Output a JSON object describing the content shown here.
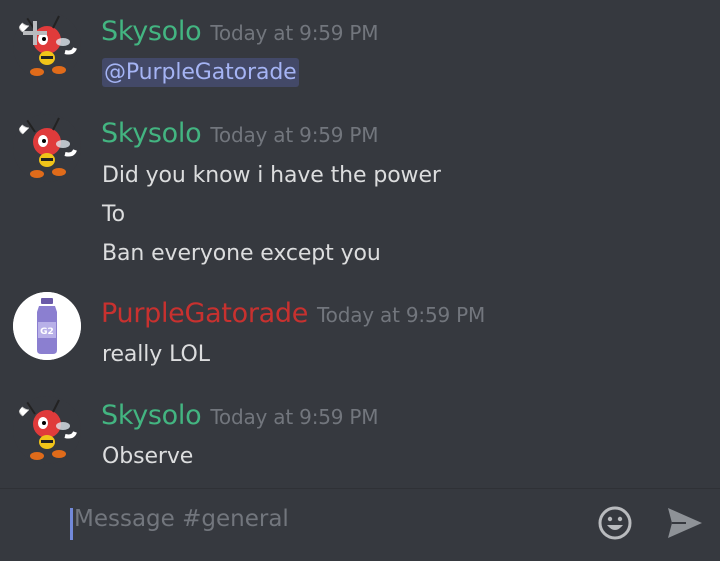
{
  "colors": {
    "background": "#36393f",
    "skysolo_name": "#43b581",
    "purple_name": "#c8312f",
    "mention_bg": "#434968",
    "mention_text": "#a5b4f4",
    "timestamp": "#72767d",
    "message_text": "#dcddde",
    "caret": "#7289da"
  },
  "messages": [
    {
      "author": "Skysolo",
      "timestamp": "Today at 9:59 PM",
      "avatar": "charmy-bee-avatar",
      "lines": [],
      "mention": "@PurpleGatorade"
    },
    {
      "author": "Skysolo",
      "timestamp": "Today at 9:59 PM",
      "avatar": "charmy-bee-avatar",
      "lines": [
        "Did you know i have the power",
        "To",
        "Ban everyone except you"
      ]
    },
    {
      "author": "PurpleGatorade",
      "timestamp": "Today at 9:59 PM",
      "avatar": "gatorade-bottle-avatar",
      "lines": [
        "really LOL"
      ]
    },
    {
      "author": "Skysolo",
      "timestamp": "Today at 9:59 PM",
      "avatar": "charmy-bee-avatar",
      "lines": [
        "Observe"
      ]
    }
  ],
  "composer": {
    "placeholder": "Message #general",
    "add_icon": "plus-icon",
    "emoji_icon": "emoji-icon",
    "send_icon": "send-icon"
  }
}
